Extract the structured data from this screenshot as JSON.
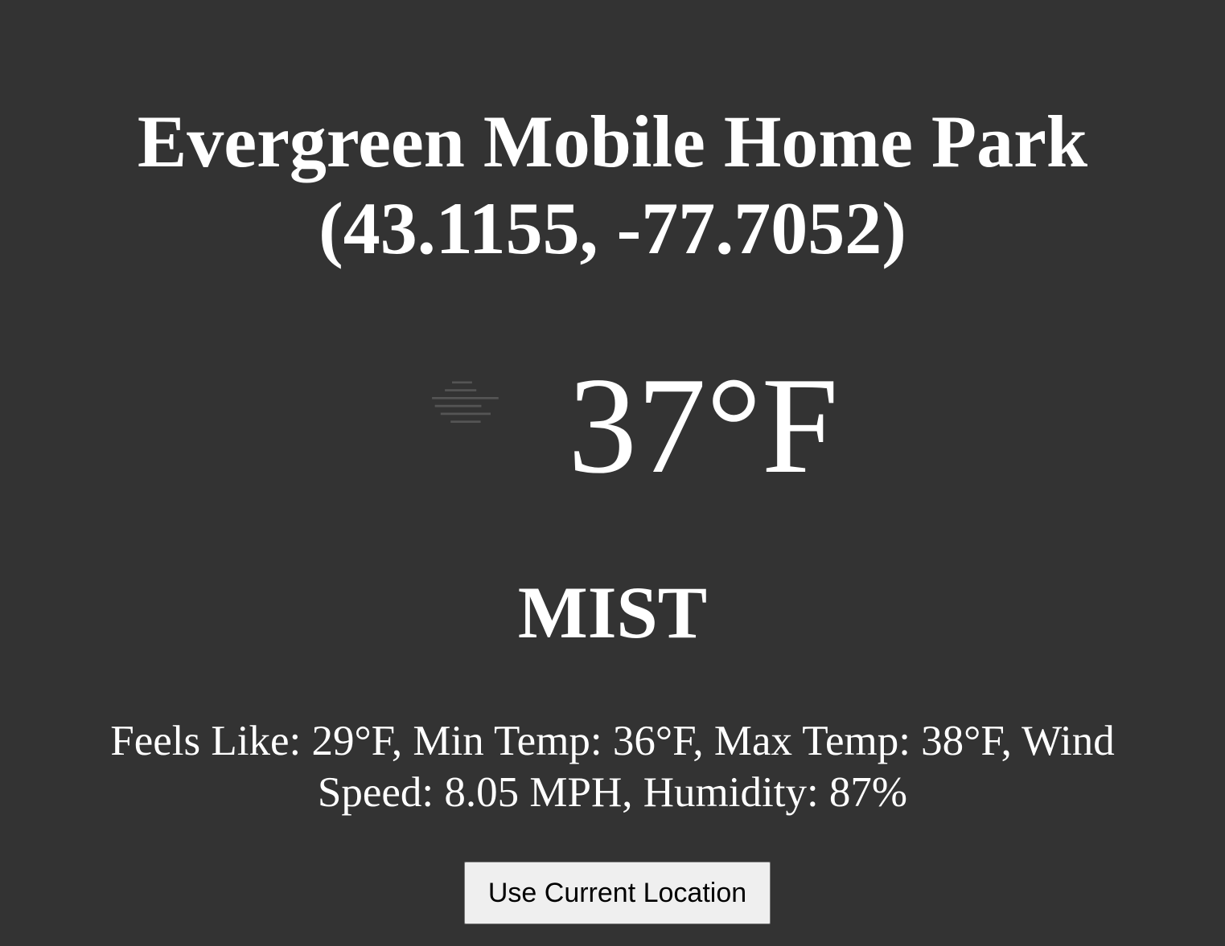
{
  "location": {
    "title": "Evergreen Mobile Home Park (43.1155, -77.7052)"
  },
  "current": {
    "icon": "mist-icon",
    "temperature": "37°F",
    "condition": "MIST"
  },
  "details": {
    "text": "Feels Like: 29°F, Min Temp: 36°F, Max Temp: 38°F, Wind Speed: 8.05 MPH, Humidity: 87%"
  },
  "actions": {
    "use_location_label": "Use Current Location"
  },
  "colors": {
    "background": "#333333",
    "text": "#ffffff",
    "icon": "#555555",
    "button_bg": "#efefef"
  }
}
